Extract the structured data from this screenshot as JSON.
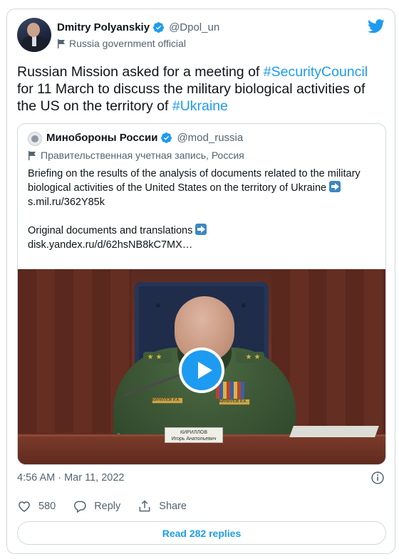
{
  "author": {
    "display_name": "Dmitry Polyanskiy",
    "handle": "@Dpol_un",
    "label": "Russia government official"
  },
  "tweet": {
    "text_before_1": "Russian Mission asked for a meeting of ",
    "hashtag_1": "#SecurityCouncil",
    "text_middle": " for 11 March to discuss the military biological activities of the US on the territory of ",
    "hashtag_2": "#Ukraine"
  },
  "quoted": {
    "display_name": "Минобороны России",
    "handle": "@mod_russia",
    "label": "Правительственная учетная запись, Россия",
    "line_1": "Briefing on the results of the analysis of documents related to the military biological activities of the United States on the territory of Ukraine ",
    "link_1": "s.mil.ru/362Y85k",
    "line_2": "Original documents and translations ",
    "link_2": "disk.yandex.ru/d/62hsNB8kC7MX…",
    "video": {
      "nameplate_line_1": "КИРИЛЛОВ",
      "nameplate_line_2": "Игорь Анатольевич",
      "badge_left": "КИРИЛЛОВ И.А.",
      "badge_right": "КИРИЛЛОВ И.А."
    }
  },
  "footer": {
    "timestamp": "4:56 AM · Mar 11, 2022",
    "like_count": "580",
    "reply_label": "Reply",
    "share_label": "Share",
    "read_replies_label": "Read 282 replies"
  },
  "colors": {
    "accent": "#1d9bf0",
    "secondary_text": "#536471",
    "border": "#cfd9de"
  }
}
